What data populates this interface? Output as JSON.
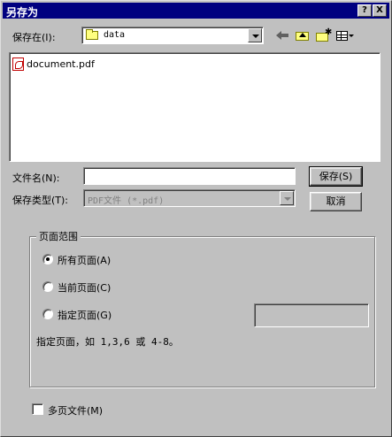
{
  "window": {
    "title": "另存为",
    "help_label": "?",
    "close_label": "X"
  },
  "save_in": {
    "label": "保存在(I):",
    "value": "data"
  },
  "files": [
    {
      "name": "document.pdf",
      "icon": "pdf-file-icon"
    }
  ],
  "filename": {
    "label": "文件名(N):",
    "value": ""
  },
  "filetype": {
    "label": "保存类型(T):",
    "value": "PDF文件 (*.pdf)"
  },
  "buttons": {
    "save": "保存(S)",
    "cancel": "取消"
  },
  "page_range": {
    "title": "页面范围",
    "all_pages": "所有页面(A)",
    "current_page": "当前页面(C)",
    "specified_pages": "指定页面(G)",
    "specified_value": "",
    "hint": "指定页面，如 1,3,6 或 4-8。"
  },
  "multi_file": {
    "label": "多页文件(M)",
    "checked": false
  }
}
